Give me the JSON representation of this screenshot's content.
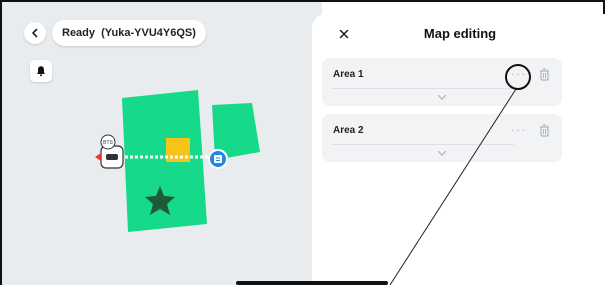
{
  "map": {
    "back_icon": "chevron-left-icon",
    "status_text": "Ready  (Yuka-YVU4Y6QS)",
    "bell_icon": "bell-icon",
    "robot_badge_text": "BTS"
  },
  "panel": {
    "close_icon": "close-icon",
    "title": "Map editing",
    "areas": [
      {
        "label": "Area 1",
        "more_icon": "more-horizontal-icon",
        "delete_icon": "trash-icon",
        "expand_icon": "chevron-down-icon"
      },
      {
        "label": "Area 2",
        "more_icon": "more-horizontal-icon",
        "delete_icon": "trash-icon",
        "expand_icon": "chevron-down-icon"
      }
    ]
  },
  "colors": {
    "area_green": "#16d98a",
    "zone_yellow": "#f7c21a",
    "star_green": "#1f5a36",
    "dock_blue": "#1e88e5",
    "map_bg": "#e9ecef",
    "card_bg": "#f2f3f5"
  }
}
